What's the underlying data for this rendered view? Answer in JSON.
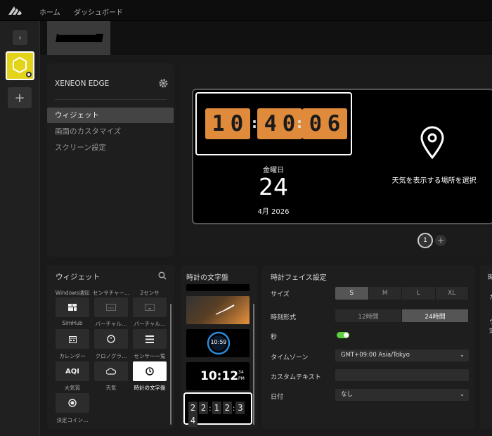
{
  "nav": {
    "home": "ホーム",
    "dashboard": "ダッシュボード"
  },
  "device": {
    "title": "XENEON EDGE"
  },
  "menu": [
    "ウィジェット",
    "画面のカスタマイズ",
    "スクリーン設定"
  ],
  "preview": {
    "time": [
      "1",
      "0",
      "4",
      "0",
      "0",
      "6"
    ],
    "weekday": "金曜日",
    "day": "24",
    "month_year": "4月 2026",
    "weather_text": "天気を表示する場所を選択",
    "page": "1"
  },
  "widgets": {
    "title": "ウィジェット",
    "top_row": [
      "Windows通知",
      "センサチャー…",
      "2センサ"
    ],
    "tiles": [
      {
        "label": "SimHub",
        "icon": "grid-icon"
      },
      {
        "label": "バーチャル…",
        "icon": "keyboard-icon"
      },
      {
        "label": "バーチャル…",
        "icon": "touchpad-icon"
      },
      {
        "label": "カレンダー",
        "icon": "calendar-icon"
      },
      {
        "label": "クロノグラ…",
        "icon": "stopwatch-icon"
      },
      {
        "label": "センサー一覧",
        "icon": "list-icon"
      },
      {
        "label": "大気質",
        "icon": "AQI"
      },
      {
        "label": "天気",
        "icon": "cloud-icon"
      },
      {
        "label": "時計の文字盤",
        "icon": "clock-icon"
      },
      {
        "label": "決定コイン…",
        "icon": "coin-icon"
      }
    ]
  },
  "faces": {
    "title": "時計の文字盤",
    "digital_time": "10:12",
    "digital_sec": "34",
    "digital_ampm": "PM",
    "circle_time": "10:59",
    "flip_time": [
      "2",
      "2",
      "1",
      "2",
      "3",
      "4"
    ]
  },
  "settings": {
    "title": "時計フェイス設定",
    "size_label": "サイズ",
    "sizes": [
      "S",
      "M",
      "L",
      "XL"
    ],
    "size_selected": "S",
    "format_label": "時刻形式",
    "formats": [
      "12時間",
      "24時間"
    ],
    "format_selected": "24時間",
    "seconds_label": "秒",
    "seconds_on": true,
    "tz_label": "タイムゾーン",
    "tz_value": "GMT+09:00 Asia/Tokyo",
    "custom_label": "カスタムテキスト",
    "custom_value": "",
    "date_label": "日付",
    "date_value": "なし"
  },
  "right_panel": {
    "title": "時",
    "c1": "カ",
    "c2": "ウ",
    "c3": "定"
  },
  "colors": {
    "accent_yellow": "#e3d319",
    "flip_orange": "#e08a3c",
    "toggle_green": "#5ccf3f"
  }
}
